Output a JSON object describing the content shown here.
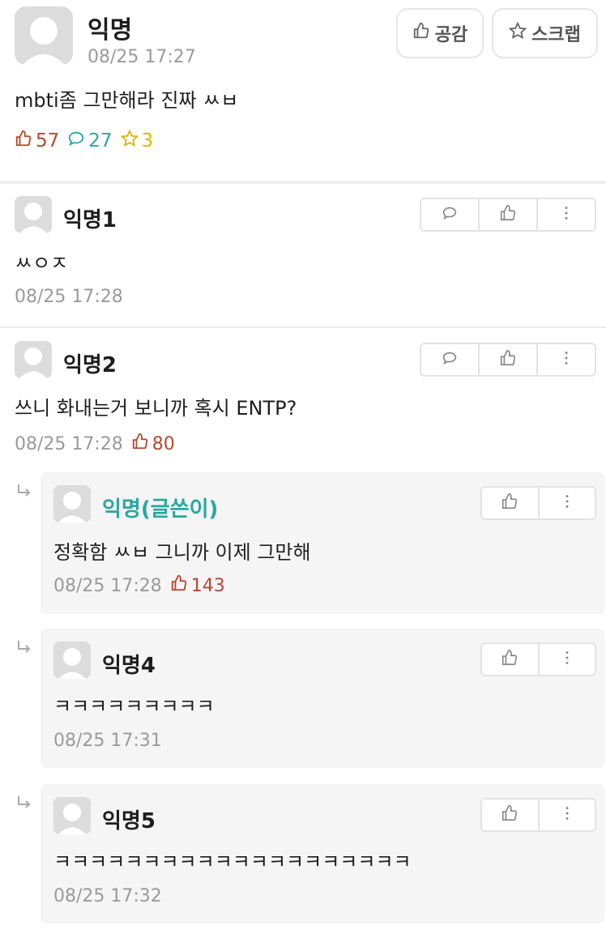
{
  "post": {
    "author": "익명",
    "time": "08/25 17:27",
    "body": "mbti좀 그만해라 진짜 ㅆㅂ",
    "buttons": {
      "like": "공감",
      "scrap": "스크랩"
    },
    "stats": {
      "likes": "57",
      "comments": "27",
      "scraps": "3"
    }
  },
  "comments": [
    {
      "author": "익명1",
      "body": "ㅆㅇㅈ",
      "time": "08/25 17:28",
      "likes": ""
    },
    {
      "author": "익명2",
      "body": "쓰니 화내는거 보니까 혹시 ENTP?",
      "time": "08/25 17:28",
      "likes": "80"
    }
  ],
  "replies": [
    {
      "author": "익명(글쓴이)",
      "body": "정확함 ㅆㅂ 그니까 이제 그만해",
      "time": "08/25 17:28",
      "likes": "143"
    },
    {
      "author": "익명4",
      "body": "ㅋㅋㅋㅋㅋㅋㅋㅋㅋ",
      "time": "08/25 17:31",
      "likes": ""
    },
    {
      "author": "익명5",
      "body": "ㅋㅋㅋㅋㅋㅋㅋㅋㅋㅋㅋㅋㅋㅋㅋㅋㅋㅋㅋㅋ",
      "time": "08/25 17:32",
      "likes": ""
    }
  ],
  "colors": {
    "like": "#b5472f",
    "comment": "#2aa7a0",
    "scrap": "#e0b500",
    "op": "#2aa7a0"
  },
  "icons": {
    "like": "thumbs-up-icon",
    "comment": "speech-bubble-icon",
    "scrap": "star-icon",
    "more": "more-vertical-icon",
    "reply": "reply-arrow-icon"
  }
}
